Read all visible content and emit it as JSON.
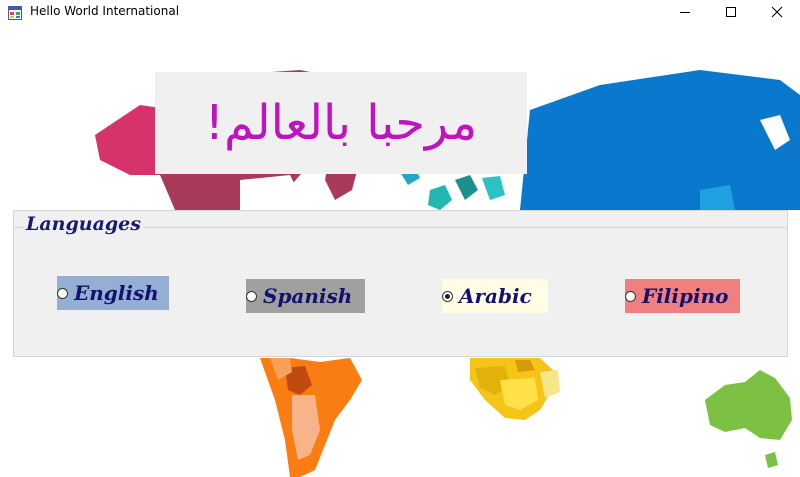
{
  "window": {
    "title": "Hello World International",
    "controls": [
      "minimize",
      "maximize",
      "close"
    ]
  },
  "banner": {
    "text": "مرحبا بالعالم!",
    "color": "#c012c0"
  },
  "languages": {
    "group_title": "Languages",
    "options": [
      {
        "label": "English",
        "checked": false,
        "background": "#94aed4"
      },
      {
        "label": "Spanish",
        "checked": false,
        "background": "#a0a0a0"
      },
      {
        "label": "Arabic",
        "checked": true,
        "background": "#fffde6"
      },
      {
        "label": "Filipino",
        "checked": false,
        "background": "#f08080"
      }
    ]
  },
  "icons": {
    "app": "app-window-icon",
    "minimize": "minimize-icon",
    "maximize": "maximize-icon",
    "close": "close-icon"
  }
}
